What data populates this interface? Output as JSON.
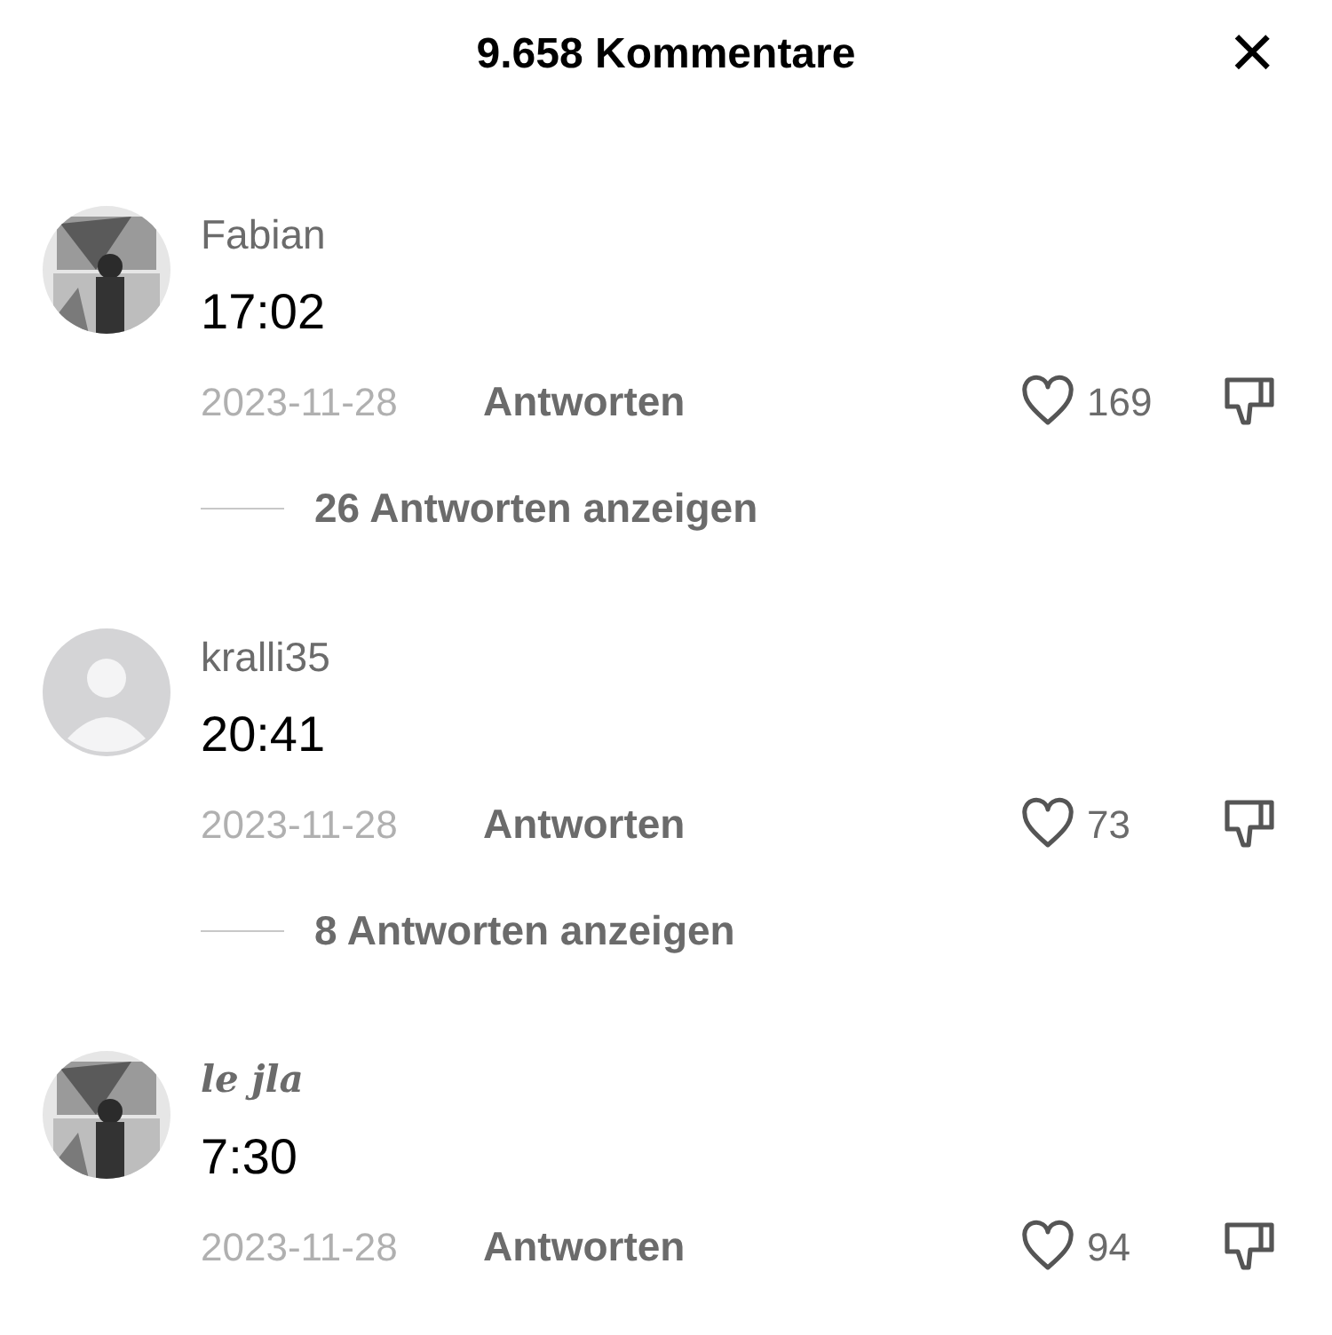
{
  "header": {
    "title": "9.658 Kommentare",
    "close": "×"
  },
  "comments": [
    {
      "author": {
        "name": "Fabian",
        "kind": "plain"
      },
      "text": "17:02",
      "date": "2023-11-28",
      "reply": "Antworten",
      "likes": "169",
      "replies": "26 Antworten anzeigen"
    },
    {
      "avatar": {
        "kind": "placeholder"
      },
      "author": {
        "name": "kralli35",
        "kind": "plain"
      },
      "text": "20:41",
      "date": "2023-11-28",
      "reply": "Antworten",
      "likes": "73",
      "replies": "8 Antworten anzeigen"
    },
    {
      "author": {
        "name": "le jla",
        "kind": "styled"
      },
      "text": "7:30",
      "date": "2023-11-28",
      "reply": "Antworten",
      "likes": "94"
    }
  ]
}
